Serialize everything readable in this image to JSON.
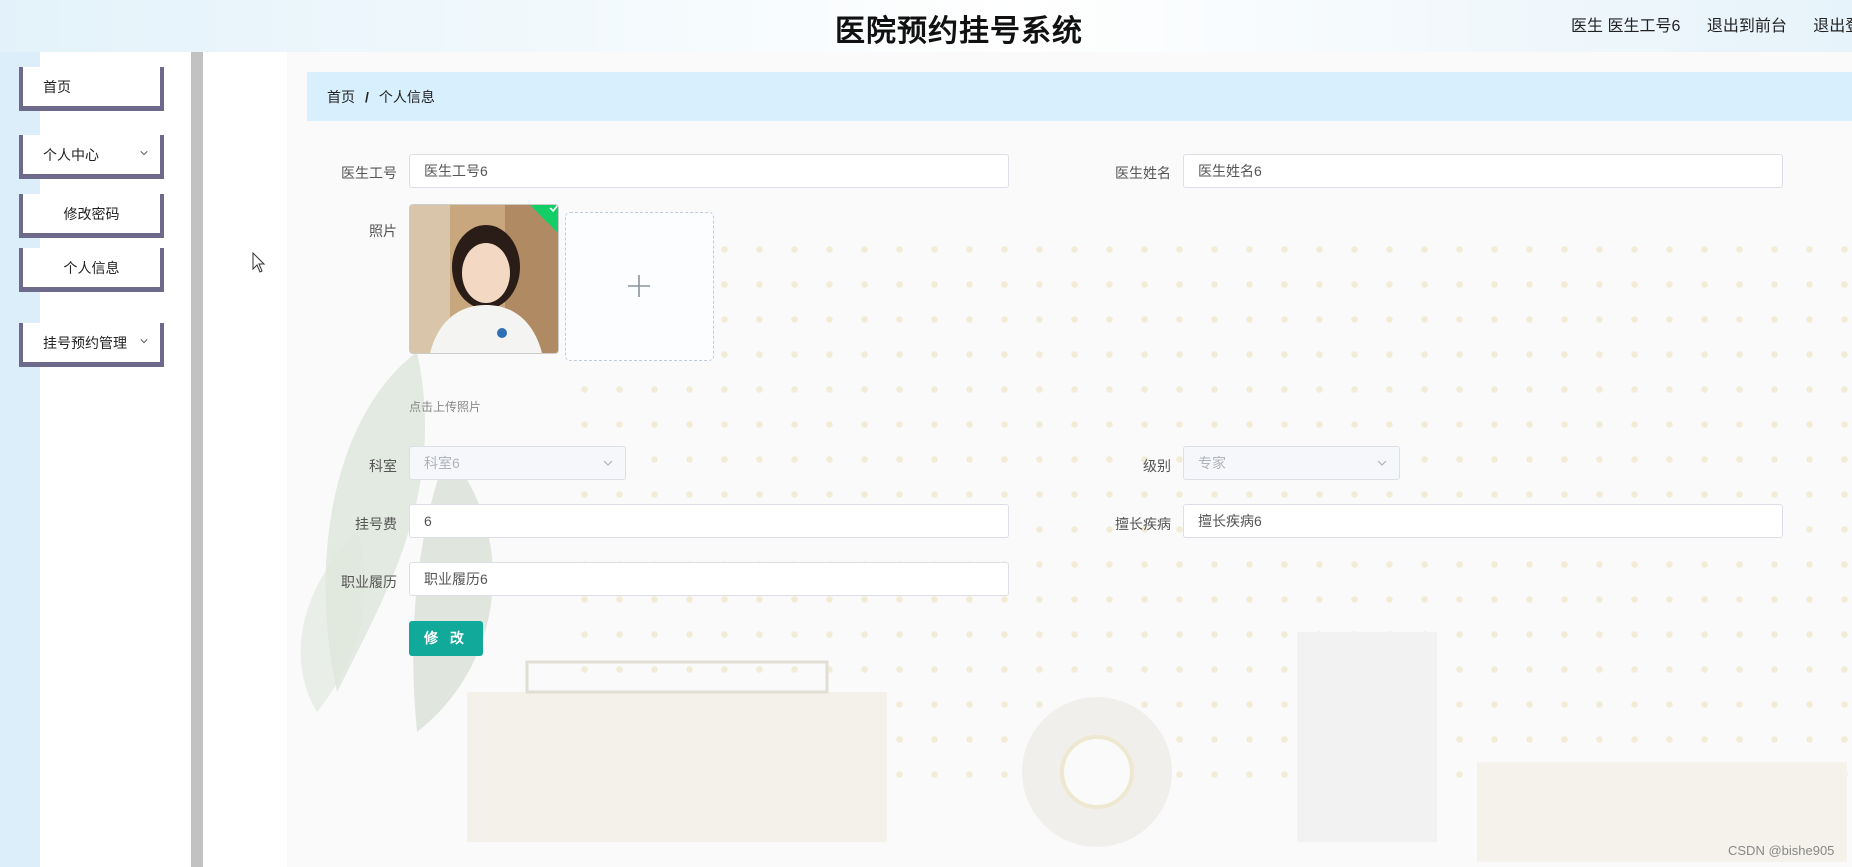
{
  "header": {
    "title": "医院预约挂号系统",
    "user": "医生 医生工号6",
    "to_front": "退出到前台",
    "logout": "退出登录"
  },
  "sidebar": {
    "items": [
      {
        "label": "首页"
      },
      {
        "label": "个人中心",
        "expandable": true
      },
      {
        "label": "修改密码"
      },
      {
        "label": "个人信息"
      },
      {
        "label": "挂号预约管理",
        "expandable": true
      }
    ]
  },
  "breadcrumb": {
    "home": "首页",
    "separator": "/",
    "current": "个人信息"
  },
  "form": {
    "doctor_id_label": "医生工号",
    "doctor_id": "医生工号6",
    "doctor_name_label": "医生姓名",
    "doctor_name": "医生姓名6",
    "photo_label": "照片",
    "upload_hint": "点击上传照片",
    "department_label": "科室",
    "department": "科室6",
    "level_label": "级别",
    "level": "专家",
    "fee_label": "挂号费",
    "fee": "6",
    "specialty_label": "擅长疾病",
    "specialty": "擅长疾病6",
    "resume_label": "职业履历",
    "resume": "职业履历6",
    "submit": "修 改"
  },
  "watermark": "CSDN @bishe905",
  "colors": {
    "primary_button": "#10a99a",
    "menu_border": "#6e6a8c",
    "breadcrumb_bg": "#d8effd"
  }
}
